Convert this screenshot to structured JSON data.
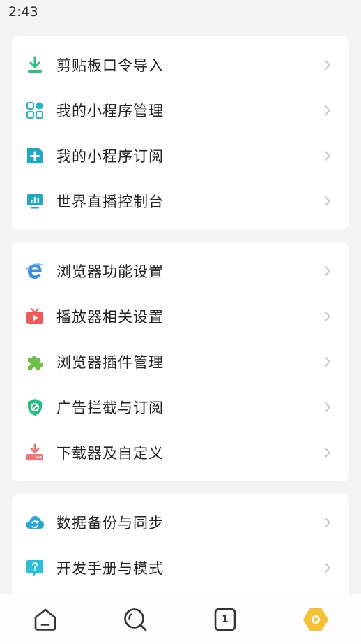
{
  "status_bar": {
    "time": "2:43"
  },
  "menu_groups": [
    {
      "items": [
        {
          "label": "剪贴板口令导入",
          "icon": "clipboard-import-icon",
          "color": "#2bc37a"
        },
        {
          "label": "我的小程序管理",
          "icon": "mini-program-grid-icon",
          "color": "#29b3c8"
        },
        {
          "label": "我的小程序订阅",
          "icon": "mini-program-subscribe-icon",
          "color": "#1fa8c4"
        },
        {
          "label": "世界直播控制台",
          "icon": "live-monitor-icon",
          "color": "#1fa8c4"
        }
      ]
    },
    {
      "items": [
        {
          "label": "浏览器功能设置",
          "icon": "browser-e-icon",
          "color": "#3d8ee6"
        },
        {
          "label": "播放器相关设置",
          "icon": "tv-player-icon",
          "color": "#f0595a"
        },
        {
          "label": "浏览器插件管理",
          "icon": "puzzle-icon",
          "color": "#6cbf47"
        },
        {
          "label": "广告拦截与订阅",
          "icon": "ad-block-shield-icon",
          "color": "#21c07d"
        },
        {
          "label": "下载器及自定义",
          "icon": "download-icon",
          "color": "#ef7677"
        }
      ]
    },
    {
      "items": [
        {
          "label": "数据备份与同步",
          "icon": "cloud-sync-icon",
          "color": "#26a9d8"
        },
        {
          "label": "开发手册与模式",
          "icon": "help-chat-icon",
          "color": "#2bbfd8"
        }
      ]
    }
  ],
  "bottom_nav": {
    "tab_count": "1",
    "active_color": "#f6c234"
  }
}
